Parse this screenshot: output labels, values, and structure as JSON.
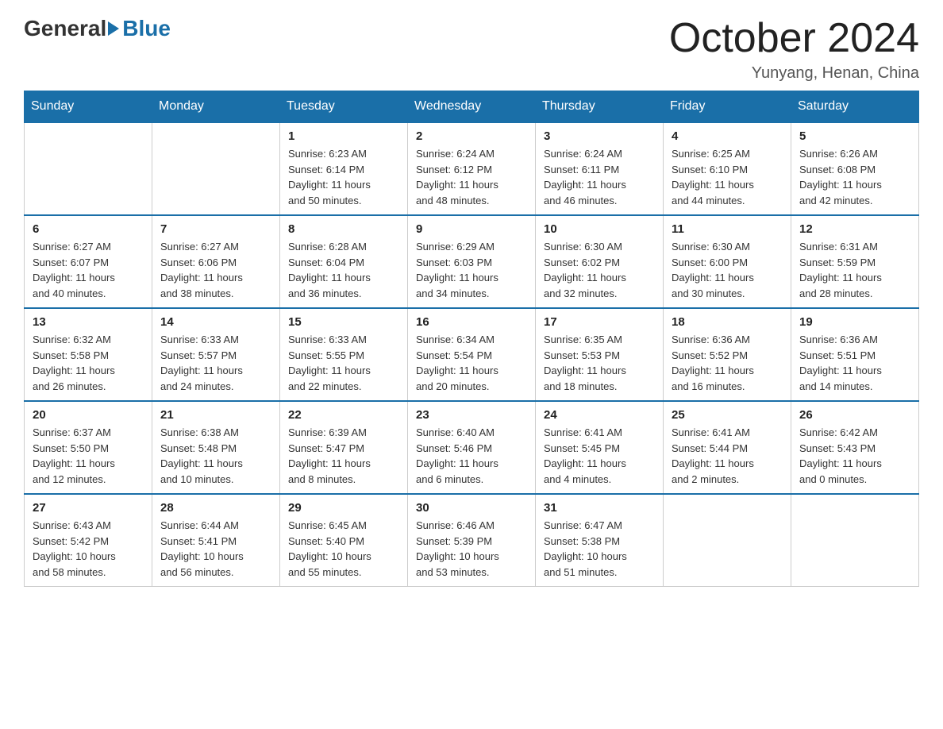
{
  "logo": {
    "general": "General",
    "blue": "Blue"
  },
  "title": "October 2024",
  "location": "Yunyang, Henan, China",
  "days_of_week": [
    "Sunday",
    "Monday",
    "Tuesday",
    "Wednesday",
    "Thursday",
    "Friday",
    "Saturday"
  ],
  "weeks": [
    [
      {
        "day": "",
        "info": ""
      },
      {
        "day": "",
        "info": ""
      },
      {
        "day": "1",
        "info": "Sunrise: 6:23 AM\nSunset: 6:14 PM\nDaylight: 11 hours\nand 50 minutes."
      },
      {
        "day": "2",
        "info": "Sunrise: 6:24 AM\nSunset: 6:12 PM\nDaylight: 11 hours\nand 48 minutes."
      },
      {
        "day": "3",
        "info": "Sunrise: 6:24 AM\nSunset: 6:11 PM\nDaylight: 11 hours\nand 46 minutes."
      },
      {
        "day": "4",
        "info": "Sunrise: 6:25 AM\nSunset: 6:10 PM\nDaylight: 11 hours\nand 44 minutes."
      },
      {
        "day": "5",
        "info": "Sunrise: 6:26 AM\nSunset: 6:08 PM\nDaylight: 11 hours\nand 42 minutes."
      }
    ],
    [
      {
        "day": "6",
        "info": "Sunrise: 6:27 AM\nSunset: 6:07 PM\nDaylight: 11 hours\nand 40 minutes."
      },
      {
        "day": "7",
        "info": "Sunrise: 6:27 AM\nSunset: 6:06 PM\nDaylight: 11 hours\nand 38 minutes."
      },
      {
        "day": "8",
        "info": "Sunrise: 6:28 AM\nSunset: 6:04 PM\nDaylight: 11 hours\nand 36 minutes."
      },
      {
        "day": "9",
        "info": "Sunrise: 6:29 AM\nSunset: 6:03 PM\nDaylight: 11 hours\nand 34 minutes."
      },
      {
        "day": "10",
        "info": "Sunrise: 6:30 AM\nSunset: 6:02 PM\nDaylight: 11 hours\nand 32 minutes."
      },
      {
        "day": "11",
        "info": "Sunrise: 6:30 AM\nSunset: 6:00 PM\nDaylight: 11 hours\nand 30 minutes."
      },
      {
        "day": "12",
        "info": "Sunrise: 6:31 AM\nSunset: 5:59 PM\nDaylight: 11 hours\nand 28 minutes."
      }
    ],
    [
      {
        "day": "13",
        "info": "Sunrise: 6:32 AM\nSunset: 5:58 PM\nDaylight: 11 hours\nand 26 minutes."
      },
      {
        "day": "14",
        "info": "Sunrise: 6:33 AM\nSunset: 5:57 PM\nDaylight: 11 hours\nand 24 minutes."
      },
      {
        "day": "15",
        "info": "Sunrise: 6:33 AM\nSunset: 5:55 PM\nDaylight: 11 hours\nand 22 minutes."
      },
      {
        "day": "16",
        "info": "Sunrise: 6:34 AM\nSunset: 5:54 PM\nDaylight: 11 hours\nand 20 minutes."
      },
      {
        "day": "17",
        "info": "Sunrise: 6:35 AM\nSunset: 5:53 PM\nDaylight: 11 hours\nand 18 minutes."
      },
      {
        "day": "18",
        "info": "Sunrise: 6:36 AM\nSunset: 5:52 PM\nDaylight: 11 hours\nand 16 minutes."
      },
      {
        "day": "19",
        "info": "Sunrise: 6:36 AM\nSunset: 5:51 PM\nDaylight: 11 hours\nand 14 minutes."
      }
    ],
    [
      {
        "day": "20",
        "info": "Sunrise: 6:37 AM\nSunset: 5:50 PM\nDaylight: 11 hours\nand 12 minutes."
      },
      {
        "day": "21",
        "info": "Sunrise: 6:38 AM\nSunset: 5:48 PM\nDaylight: 11 hours\nand 10 minutes."
      },
      {
        "day": "22",
        "info": "Sunrise: 6:39 AM\nSunset: 5:47 PM\nDaylight: 11 hours\nand 8 minutes."
      },
      {
        "day": "23",
        "info": "Sunrise: 6:40 AM\nSunset: 5:46 PM\nDaylight: 11 hours\nand 6 minutes."
      },
      {
        "day": "24",
        "info": "Sunrise: 6:41 AM\nSunset: 5:45 PM\nDaylight: 11 hours\nand 4 minutes."
      },
      {
        "day": "25",
        "info": "Sunrise: 6:41 AM\nSunset: 5:44 PM\nDaylight: 11 hours\nand 2 minutes."
      },
      {
        "day": "26",
        "info": "Sunrise: 6:42 AM\nSunset: 5:43 PM\nDaylight: 11 hours\nand 0 minutes."
      }
    ],
    [
      {
        "day": "27",
        "info": "Sunrise: 6:43 AM\nSunset: 5:42 PM\nDaylight: 10 hours\nand 58 minutes."
      },
      {
        "day": "28",
        "info": "Sunrise: 6:44 AM\nSunset: 5:41 PM\nDaylight: 10 hours\nand 56 minutes."
      },
      {
        "day": "29",
        "info": "Sunrise: 6:45 AM\nSunset: 5:40 PM\nDaylight: 10 hours\nand 55 minutes."
      },
      {
        "day": "30",
        "info": "Sunrise: 6:46 AM\nSunset: 5:39 PM\nDaylight: 10 hours\nand 53 minutes."
      },
      {
        "day": "31",
        "info": "Sunrise: 6:47 AM\nSunset: 5:38 PM\nDaylight: 10 hours\nand 51 minutes."
      },
      {
        "day": "",
        "info": ""
      },
      {
        "day": "",
        "info": ""
      }
    ]
  ]
}
